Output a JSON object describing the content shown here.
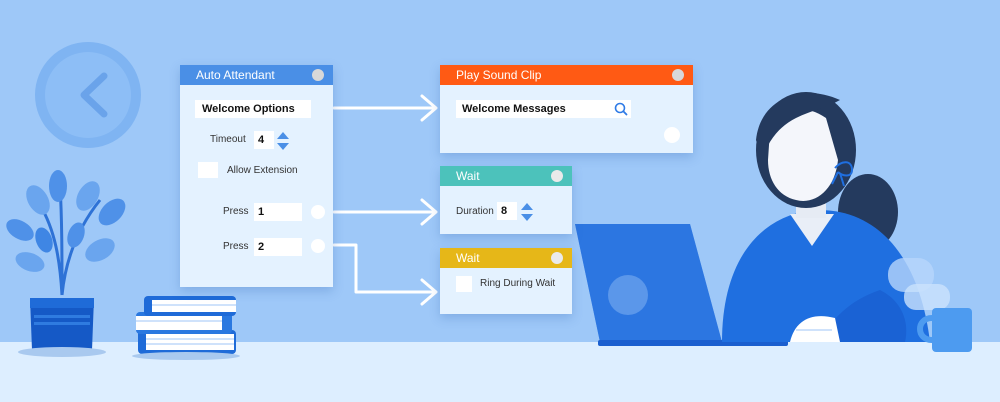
{
  "colors": {
    "background": "#9ec8f8",
    "auto_attendant_header": "#4a8fe6",
    "play_sound_header": "#ff5a14",
    "wait_header": "#4cc2bb",
    "wait_header_2": "#e6b718",
    "connector": "#ffffff"
  },
  "auto_attendant": {
    "title": "Auto Attendant",
    "welcome_options": "Welcome Options",
    "timeout_label": "Timeout",
    "timeout_value": "4",
    "allow_extension_label": "Allow Extension",
    "press_label_1": "Press",
    "press_value_1": "1",
    "press_label_2": "Press",
    "press_value_2": "2"
  },
  "play_sound_clip": {
    "title": "Play Sound Clip",
    "search_value": "Welcome Messages",
    "search_icon": "search-icon"
  },
  "wait_duration": {
    "title": "Wait",
    "duration_label": "Duration",
    "duration_value": "8"
  },
  "wait_ring": {
    "title": "Wait",
    "ring_label": "Ring During Wait"
  },
  "illustration": {
    "clock_icon": "clock-icon",
    "plant": "potted-plant",
    "books": "book-stack",
    "person": "woman-at-laptop",
    "mug": "mug"
  }
}
